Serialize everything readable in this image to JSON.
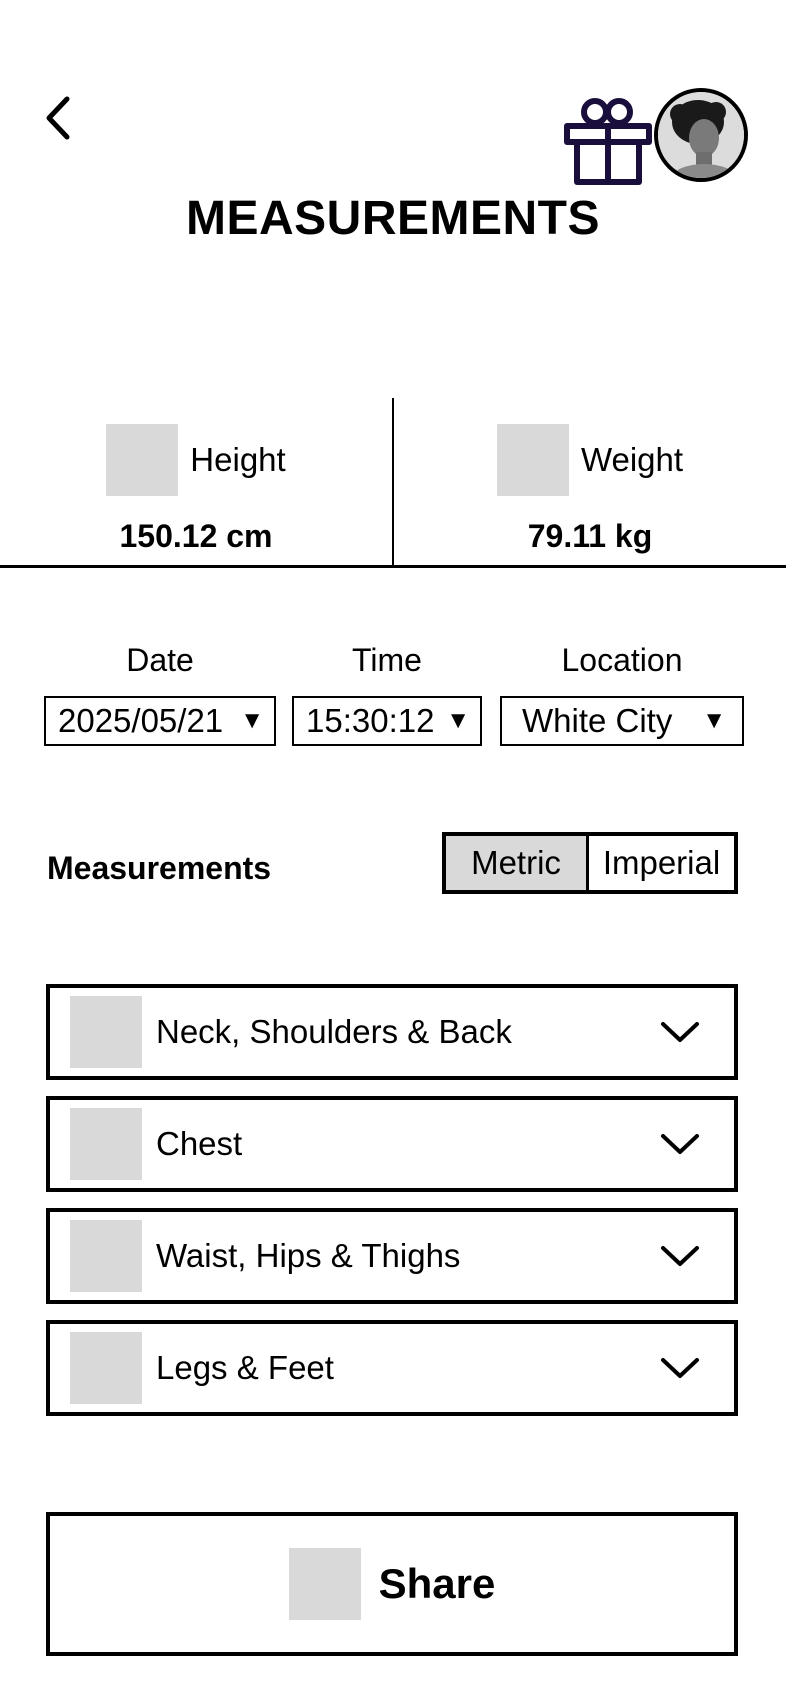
{
  "header": {
    "title": "MEASUREMENTS",
    "back_icon": "chevron-left-icon",
    "gift_icon": "gift-icon",
    "accent_color": "#1a0f3c"
  },
  "stats": {
    "height": {
      "label": "Height",
      "value": "150.12 cm"
    },
    "weight": {
      "label": "Weight",
      "value": "79.11 kg"
    }
  },
  "filters": {
    "date": {
      "label": "Date",
      "value": "2025/05/21"
    },
    "time": {
      "label": "Time",
      "value": "15:30:12"
    },
    "location": {
      "label": "Location",
      "value": "White City"
    }
  },
  "measurements": {
    "label": "Measurements",
    "units": {
      "metric": "Metric",
      "imperial": "Imperial",
      "selected": "Metric"
    },
    "groups": [
      {
        "label": "Neck, Shoulders & Back"
      },
      {
        "label": "Chest"
      },
      {
        "label": "Waist, Hips & Thighs"
      },
      {
        "label": "Legs & Feet"
      }
    ]
  },
  "share": {
    "label": "Share"
  },
  "colors": {
    "placeholder": "#d9d9d9",
    "selected_toggle": "#d9d9d9"
  }
}
